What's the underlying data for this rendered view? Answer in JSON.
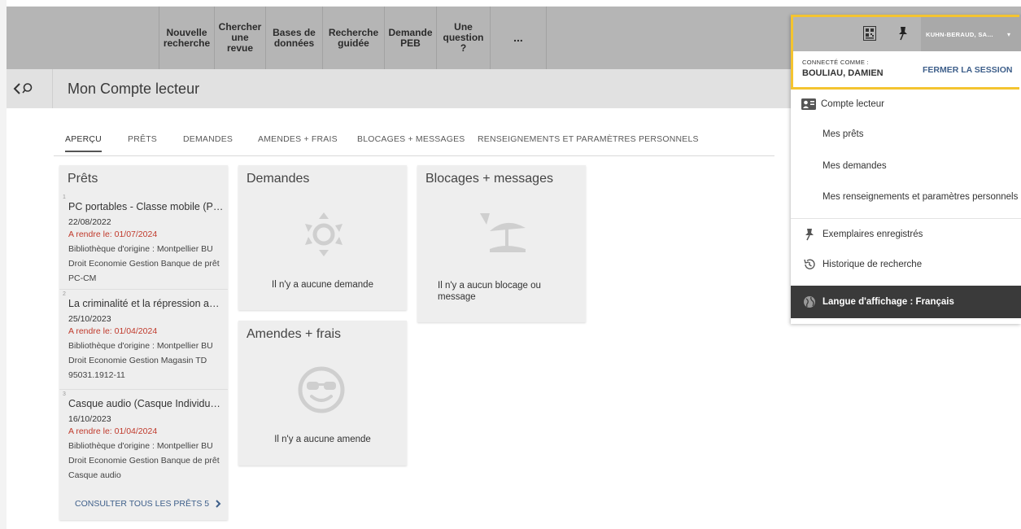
{
  "nav": {
    "items": [
      "Nouvelle\nrecherche",
      "Chercher\nune\nrevue",
      "Bases de\ndonnées",
      "Recherche\nguidée",
      "Demande\nPEB",
      "Une\nquestion\n?",
      "..."
    ]
  },
  "header": {
    "title": "Mon Compte lecteur"
  },
  "tabs": [
    "APERÇU",
    "PRÊTS",
    "DEMANDES",
    "AMENDES + FRAIS",
    "BLOCAGES + MESSAGES",
    "RENSEIGNEMENTS ET PARAMÈTRES PERSONNELS"
  ],
  "loans_card": {
    "title": "Prêts",
    "items": [
      {
        "num": "1",
        "title": "PC portables - Classe mobile (P…",
        "date": "22/08/2022",
        "due": "A rendre le: 01/07/2024",
        "info": "Bibliothèque d'origine : Montpellier BU Droit Economie Gestion Banque de prêt PC-CM"
      },
      {
        "num": "2",
        "title": "La criminalité et la répression a…",
        "date": "25/10/2023",
        "due": "A rendre le: 01/04/2024",
        "info": "Bibliothèque d'origine : Montpellier BU Droit Economie Gestion Magasin TD 95031.1912-11"
      },
      {
        "num": "3",
        "title": "Casque audio (Casque Individu…",
        "date": "16/10/2023",
        "due": "A rendre le: 01/04/2024",
        "info": "Bibliothèque d'origine : Montpellier BU Droit Economie Gestion Banque de prêt Casque audio"
      }
    ],
    "see_all": "CONSULTER TOUS LES PRÊTS 5"
  },
  "requests_card": {
    "title": "Demandes",
    "empty": "Il n'y a aucune demande"
  },
  "fines_card": {
    "title": "Amendes + frais",
    "empty": "Il n'y a aucune amende"
  },
  "blocks_card": {
    "title": "Blocages + messages",
    "empty": "Il n'y a aucun blocage ou message"
  },
  "panel": {
    "user_short": "KUHN-BERAUD, SA…",
    "connected_label": "CONNECTÉ COMME :",
    "connected_name": "BOULIAU, DAMIEN",
    "logout": "FERMER LA SESSION",
    "menu": [
      "Compte lecteur",
      "Mes prêts",
      "Mes demandes",
      "Mes renseignements et paramètres personnels",
      "Exemplaires enregistrés",
      "Historique de recherche"
    ],
    "language": "Langue d'affichage : Français"
  },
  "colors": {
    "highlight": "#f4c430",
    "due": "#c0392b",
    "link": "#3e5f8a"
  }
}
